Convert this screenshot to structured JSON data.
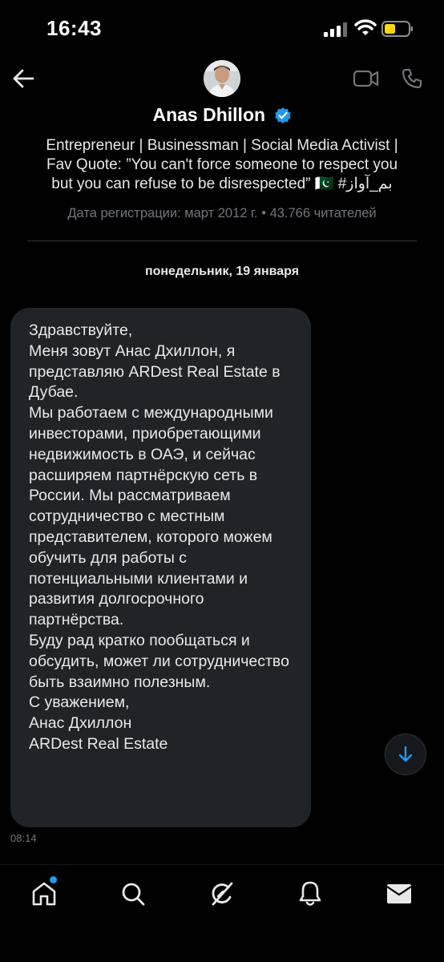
{
  "status_bar": {
    "time": "16:43"
  },
  "header": {
    "name": "Anas Dhillon",
    "bio": "Entrepreneur | Businessman | Social Media Activist |\nFav Quote: ”You can't force someone to respect you\nbut you can refuse to be disrespected” 🇵🇰 #بم_آواز",
    "joined": "Дата регистрации: март 2012 г. • 43.766 читателей"
  },
  "conversation": {
    "date_separator": "понедельник, 19 января",
    "message": {
      "text": "Здравствуйте,\nМеня зовут Анас Дхиллон, я представляю ARDest Real Estate в Дубае.\nМы работаем с международными инвесторами, приобретающими недвижимость в ОАЭ, и сейчас расширяем партнёрскую сеть в России. Мы рассматриваем сотрудничество с местным представителем, которого можем обучить для работы с потенциальными клиентами и развития долгосрочного партнёрства.\nБуду рад кратко пообщаться и обсудить, может ли сотрудничество быть взаимно полезным.\nС уважением,\nАнас Дхиллон\nARDest Real Estate",
      "time": "08:14"
    }
  },
  "colors": {
    "accent": "#1d9bf0",
    "battery": "#ffd60a",
    "bubble": "#202327"
  },
  "icons": [
    "back-arrow-icon",
    "video-call-icon",
    "phone-icon",
    "verified-badge-icon",
    "arrow-down-icon",
    "home-icon",
    "search-icon",
    "grok-icon",
    "bell-icon",
    "mail-icon"
  ]
}
